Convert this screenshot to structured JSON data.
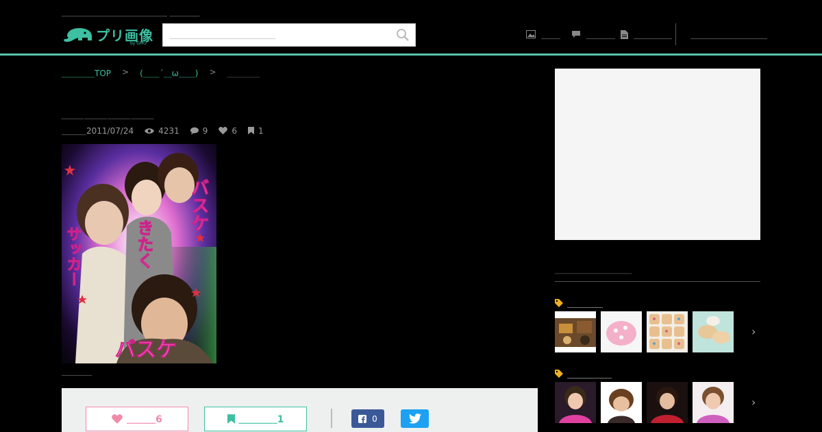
{
  "header": {
    "tagline": "＿＿＿＿＿＿＿＿＿＿＿＿＿＿ ＿＿＿＿",
    "logo_text": "プリ画像",
    "logo_sub": "by GMO",
    "search_placeholder": "＿＿＿＿＿＿＿＿＿＿＿",
    "nav": [
      {
        "label": "＿＿",
        "icon": "image-icon"
      },
      {
        "label": "＿＿＿",
        "icon": "comment-icon"
      },
      {
        "label": "＿＿＿＿",
        "icon": "document-icon"
      }
    ],
    "nav_right": [
      {
        "label": "＿＿＿＿"
      },
      {
        "label": "＿＿＿＿"
      }
    ]
  },
  "breadcrumb": {
    "top": "＿＿＿＿TOP",
    "category": "(＿＿´＿ω＿＿)",
    "current": "＿＿＿＿",
    "separator": ">"
  },
  "post": {
    "title": "＿＿＿＿",
    "date": "＿＿＿2011/07/24",
    "views": "4231",
    "comments": "9",
    "likes": "6",
    "bookmarks": "1",
    "caption": "＿＿＿＿",
    "photo_texts": [
      "バスケ",
      "きたく",
      "サッカー",
      "バスケ"
    ]
  },
  "actions": {
    "like_label": "＿＿＿6",
    "fav_label": "＿＿＿＿1",
    "fb_count": "0"
  },
  "sidebar": {
    "title": "＿＿＿＿＿＿＿",
    "tags": [
      {
        "name": "＿＿＿＿"
      },
      {
        "name": "＿＿＿＿＿"
      }
    ]
  },
  "colors": {
    "accent": "#3dbfa2",
    "like": "#f08aa8",
    "facebook": "#3b5998",
    "twitter": "#1da1f2"
  }
}
